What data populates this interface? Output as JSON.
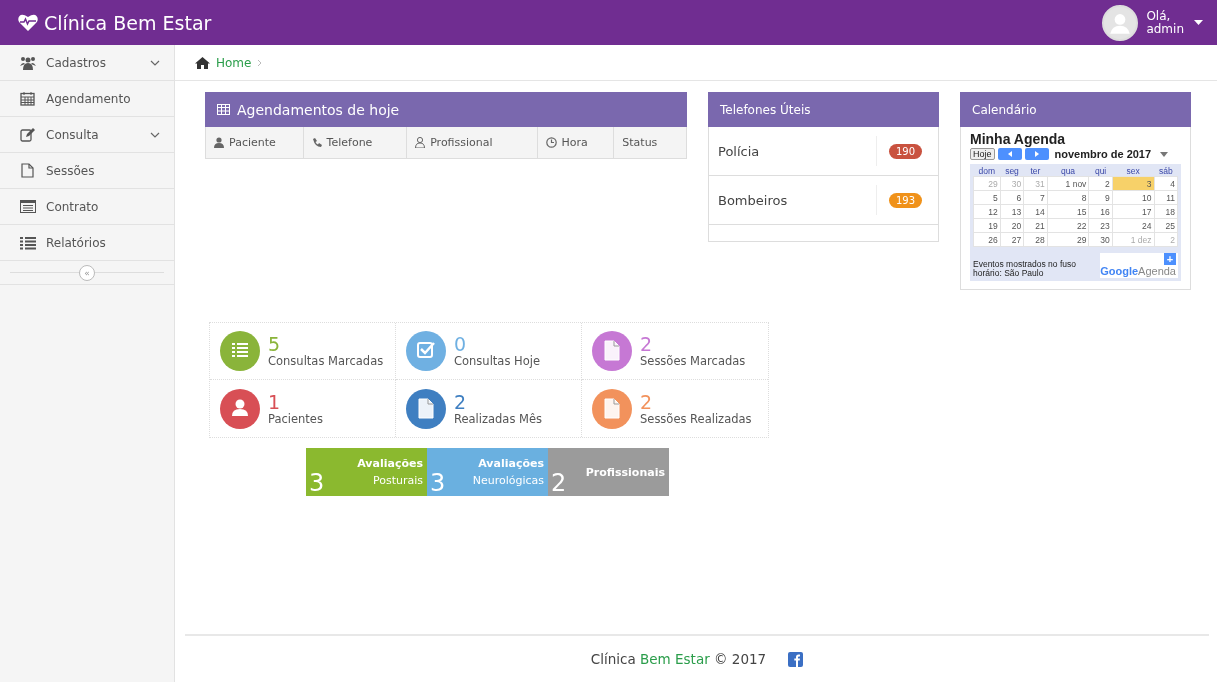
{
  "topbar": {
    "brand": "Clínica Bem Estar",
    "greeting": "Olá,",
    "user": "admin"
  },
  "sidebar": {
    "items": [
      {
        "kind": "people",
        "label": "Cadastros",
        "has_submenu": true
      },
      {
        "kind": "calendar",
        "label": "Agendamento",
        "has_submenu": false
      },
      {
        "kind": "edit",
        "label": "Consulta",
        "has_submenu": true
      },
      {
        "kind": "file",
        "label": "Sessões",
        "has_submenu": false
      },
      {
        "kind": "card",
        "label": "Contrato",
        "has_submenu": false
      },
      {
        "kind": "list",
        "label": "Relatórios",
        "has_submenu": false
      }
    ],
    "collapse": "«"
  },
  "breadcrumb": {
    "items": [
      "Home"
    ]
  },
  "appointments": {
    "title": "Agendamentos de hoje",
    "columns": [
      {
        "kind": "person",
        "label": "Paciente"
      },
      {
        "kind": "phone",
        "label": "Telefone"
      },
      {
        "kind": "professional",
        "label": "Profissional"
      },
      {
        "kind": "clock",
        "label": "Hora"
      },
      {
        "kind": "plain",
        "label": "Status"
      }
    ]
  },
  "phones": {
    "title": "Telefones Úteis",
    "items": [
      {
        "name": "Polícia",
        "number": "190",
        "color": "#c9523f"
      },
      {
        "name": "Bombeiros",
        "number": "193",
        "color": "#f0921a"
      }
    ]
  },
  "calendar": {
    "title": "Calendário",
    "agenda_title": "Minha Agenda",
    "today_button": "Hoje",
    "month": "novembro de 2017",
    "weekdays": [
      "dom",
      "seg",
      "ter",
      "qua",
      "qui",
      "sex",
      "sáb"
    ],
    "weeks": [
      [
        {
          "label": "29",
          "other_month": true,
          "selected": false
        },
        {
          "label": "30",
          "other_month": true,
          "selected": false
        },
        {
          "label": "31",
          "other_month": true,
          "selected": false
        },
        {
          "label": "1 nov",
          "other_month": false,
          "selected": false
        },
        {
          "label": "2",
          "other_month": false,
          "selected": false
        },
        {
          "label": "3",
          "other_month": false,
          "selected": true
        },
        {
          "label": "4",
          "other_month": false,
          "selected": false
        }
      ],
      [
        {
          "label": "5",
          "other_month": false,
          "selected": false
        },
        {
          "label": "6",
          "other_month": false,
          "selected": false
        },
        {
          "label": "7",
          "other_month": false,
          "selected": false
        },
        {
          "label": "8",
          "other_month": false,
          "selected": false
        },
        {
          "label": "9",
          "other_month": false,
          "selected": false
        },
        {
          "label": "10",
          "other_month": false,
          "selected": false
        },
        {
          "label": "11",
          "other_month": false,
          "selected": false
        }
      ],
      [
        {
          "label": "12",
          "other_month": false,
          "selected": false
        },
        {
          "label": "13",
          "other_month": false,
          "selected": false
        },
        {
          "label": "14",
          "other_month": false,
          "selected": false
        },
        {
          "label": "15",
          "other_month": false,
          "selected": false
        },
        {
          "label": "16",
          "other_month": false,
          "selected": false
        },
        {
          "label": "17",
          "other_month": false,
          "selected": false
        },
        {
          "label": "18",
          "other_month": false,
          "selected": false
        }
      ],
      [
        {
          "label": "19",
          "other_month": false,
          "selected": false
        },
        {
          "label": "20",
          "other_month": false,
          "selected": false
        },
        {
          "label": "21",
          "other_month": false,
          "selected": false
        },
        {
          "label": "22",
          "other_month": false,
          "selected": false
        },
        {
          "label": "23",
          "other_month": false,
          "selected": false
        },
        {
          "label": "24",
          "other_month": false,
          "selected": false
        },
        {
          "label": "25",
          "other_month": false,
          "selected": false
        }
      ],
      [
        {
          "label": "26",
          "other_month": false,
          "selected": false
        },
        {
          "label": "27",
          "other_month": false,
          "selected": false
        },
        {
          "label": "28",
          "other_month": false,
          "selected": false
        },
        {
          "label": "29",
          "other_month": false,
          "selected": false
        },
        {
          "label": "30",
          "other_month": false,
          "selected": false
        },
        {
          "label": "1 dez",
          "other_month": true,
          "selected": false
        },
        {
          "label": "2",
          "other_month": true,
          "selected": false
        }
      ]
    ],
    "timezone_note": "Eventos mostrados no fuso horário: São Paulo",
    "logo_brand": "Google",
    "logo_product": "Agenda",
    "add_button": "+"
  },
  "stats": [
    {
      "kind": "list",
      "value": "5",
      "label": "Consultas Marcadas",
      "color": "#8ab43a"
    },
    {
      "kind": "check",
      "value": "0",
      "label": "Consultas Hoje",
      "color": "#6fb0e2"
    },
    {
      "kind": "file",
      "value": "2",
      "label": "Sessões Marcadas",
      "color": "#c678d4"
    },
    {
      "kind": "user",
      "value": "1",
      "label": "Pacientes",
      "color": "#d84f55"
    },
    {
      "kind": "file",
      "value": "2",
      "label": "Realizadas Mês",
      "color": "#3f7fc1"
    },
    {
      "kind": "file",
      "value": "2",
      "label": "Sessões Realizadas",
      "color": "#f2925c"
    }
  ],
  "tiles": [
    {
      "value": "3",
      "line1": "Avaliações",
      "line2": "Posturais",
      "color": "#8bb92f"
    },
    {
      "value": "3",
      "line1": "Avaliações",
      "line2": "Neurológicas",
      "color": "#6ab0e0"
    },
    {
      "value": "2",
      "line1": "Profissionais",
      "color": "#9b9b9b"
    }
  ],
  "footer": {
    "text": "Clínica **Bem Estar** © 2017"
  }
}
